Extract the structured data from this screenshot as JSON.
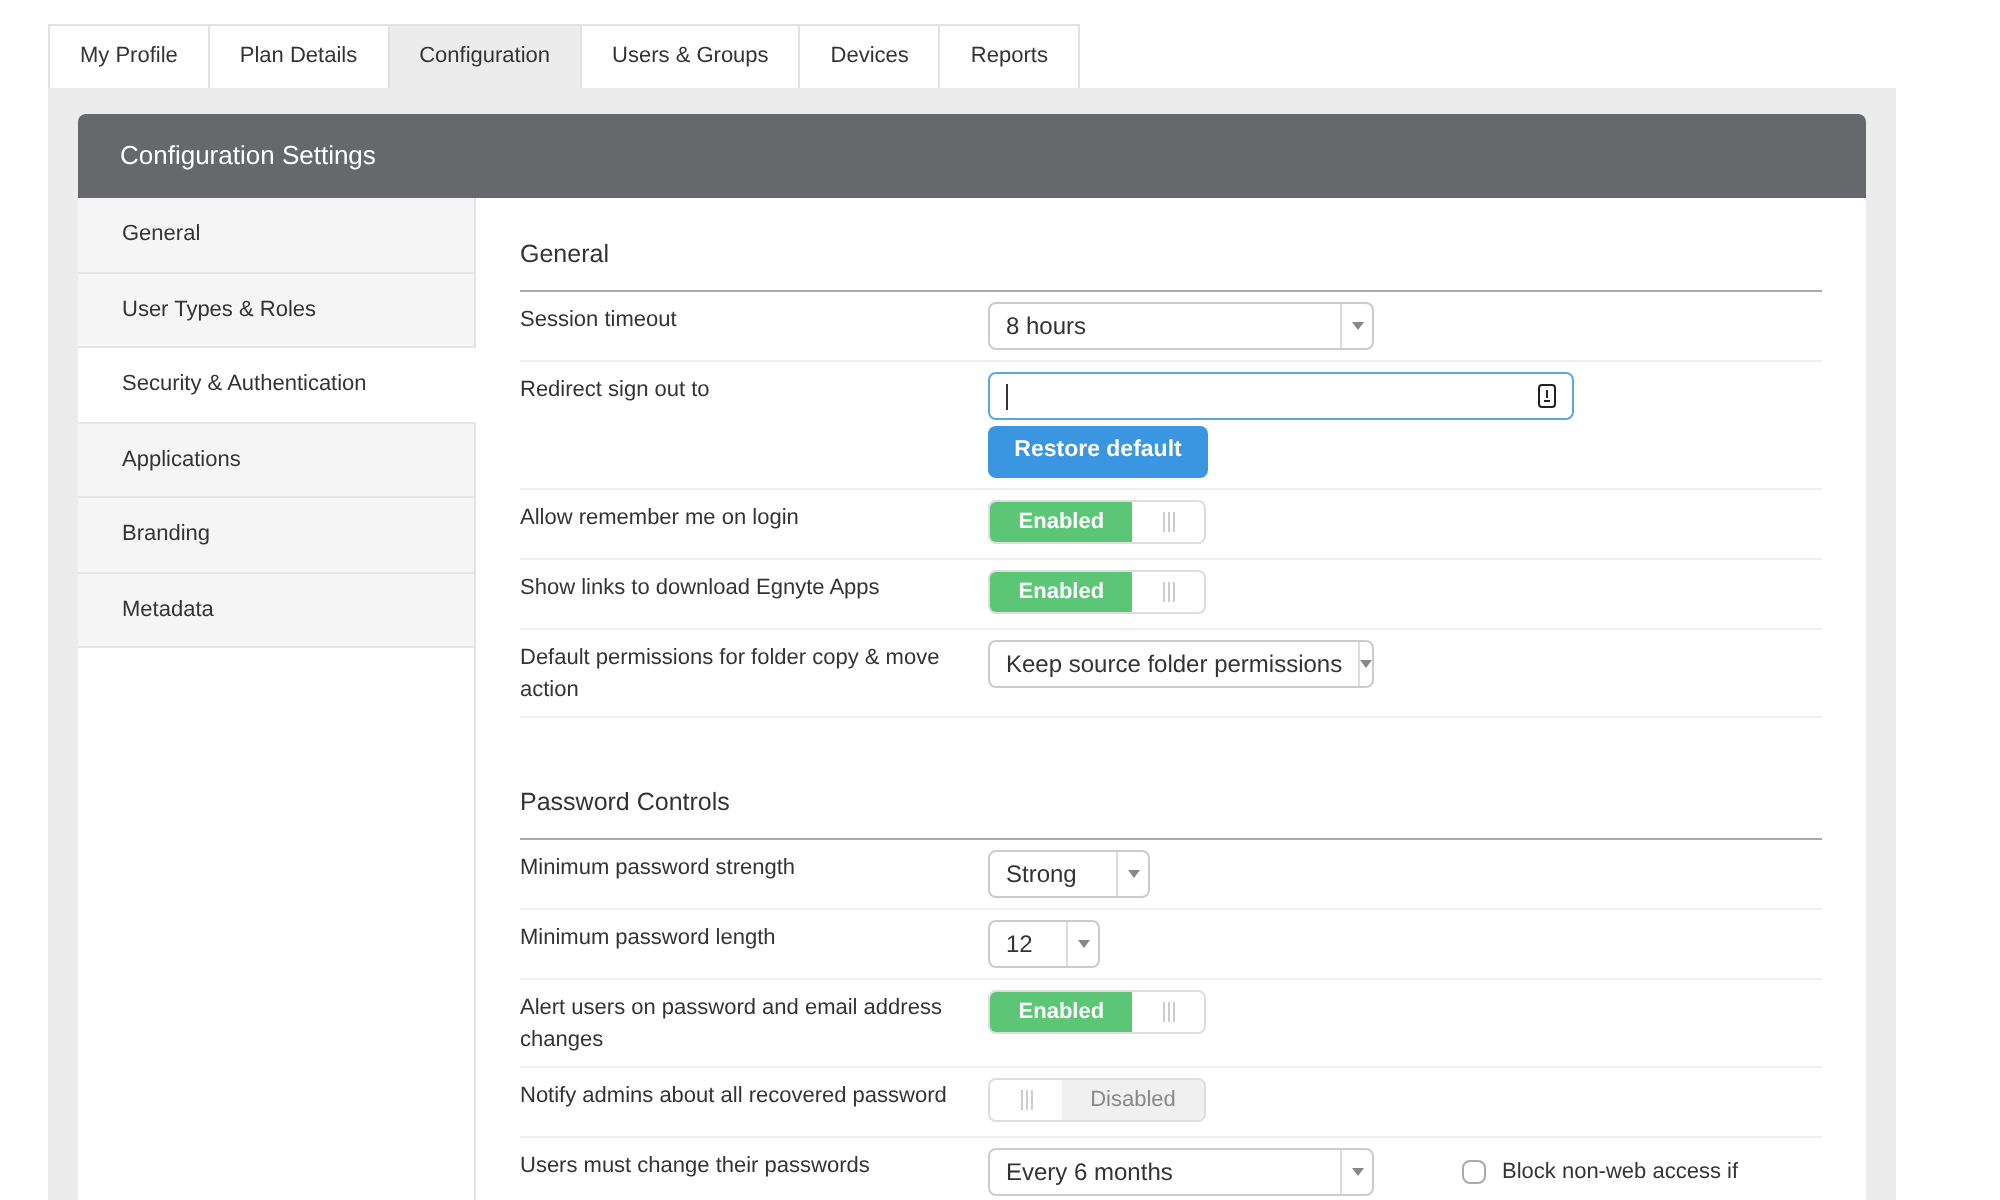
{
  "tabs": [
    {
      "label": "My Profile",
      "selected": false
    },
    {
      "label": "Plan Details",
      "selected": false
    },
    {
      "label": "Configuration",
      "selected": true
    },
    {
      "label": "Users & Groups",
      "selected": false
    },
    {
      "label": "Devices",
      "selected": false
    },
    {
      "label": "Reports",
      "selected": false
    }
  ],
  "panel": {
    "title": "Configuration Settings"
  },
  "sidebar": {
    "items": [
      {
        "label": "General",
        "selected": false
      },
      {
        "label": "User Types & Roles",
        "selected": false
      },
      {
        "label": "Security & Authentication",
        "selected": true
      },
      {
        "label": "Applications",
        "selected": false
      },
      {
        "label": "Branding",
        "selected": false
      },
      {
        "label": "Metadata",
        "selected": false
      }
    ]
  },
  "sections": [
    {
      "title": "General",
      "rows": [
        {
          "kind": "select",
          "label": "Session timeout",
          "value": "8 hours"
        },
        {
          "kind": "input",
          "label": "Redirect sign out to",
          "focused": true,
          "button": "Restore default"
        },
        {
          "kind": "toggle",
          "label": "Allow remember me on login",
          "on": true,
          "state_label": "Enabled"
        },
        {
          "kind": "toggle",
          "label": "Show links to download Egnyte Apps",
          "on": true,
          "state_label": "Enabled"
        },
        {
          "kind": "select",
          "label": "Default permissions for folder copy & move action",
          "value": "Keep source folder permissions"
        }
      ]
    },
    {
      "title": "Password Controls",
      "rows": [
        {
          "kind": "select",
          "label": "Minimum password strength",
          "value": "Strong"
        },
        {
          "kind": "select",
          "label": "Minimum password length",
          "value": "12"
        },
        {
          "kind": "toggle",
          "label": "Alert users on password and email address changes",
          "on": true,
          "state_label": "Enabled"
        },
        {
          "kind": "toggle",
          "label": "Notify admins about all recovered password",
          "on": false,
          "state_label": "Disabled"
        },
        {
          "kind": "select",
          "label": "Users must change their passwords",
          "value": "Every 6 months",
          "checkbox": {
            "label": "Block non-web access if",
            "checked": false
          }
        }
      ]
    }
  ]
}
